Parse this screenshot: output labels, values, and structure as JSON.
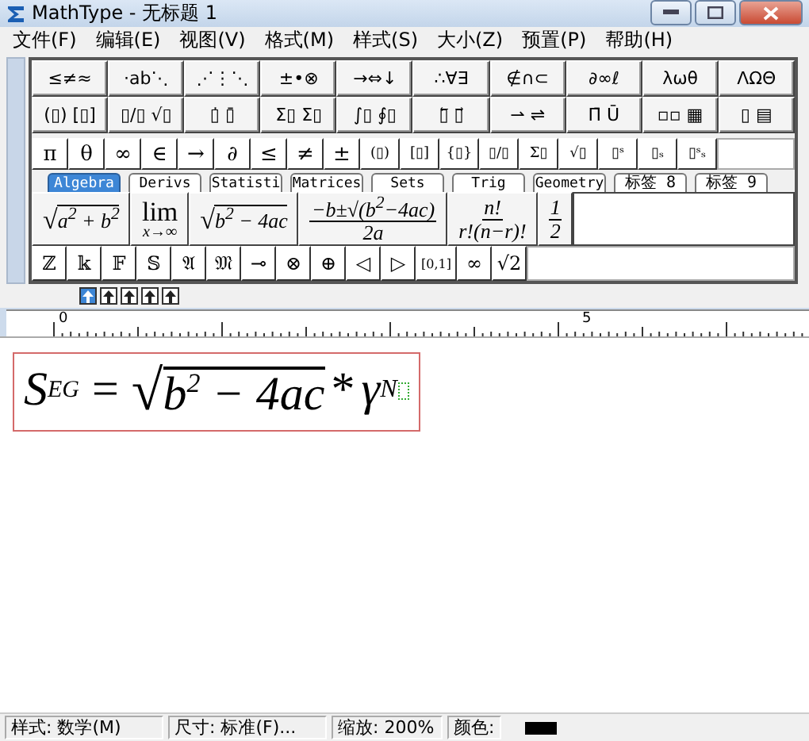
{
  "window": {
    "title": "MathType - 无标题 1"
  },
  "menu": [
    "文件(F)",
    "编辑(E)",
    "视图(V)",
    "格式(M)",
    "样式(S)",
    "大小(Z)",
    "预置(P)",
    "帮助(H)"
  ],
  "symbol_rows": [
    [
      "≤≠≈",
      "⋅ab⋱",
      "⋰⋮⋱",
      "±•⊗",
      "→⇔↓",
      "∴∀∃",
      "∉∩⊂",
      "∂∞ℓ",
      "λωθ",
      "ΛΩΘ"
    ],
    [
      "(▯) [▯]",
      "▯/▯ √▯",
      "▯̇ ▯̄",
      "Σ▯ Σ▯",
      "∫▯ ∮▯",
      "▯⃖ ▯⃗",
      "⇀ ⇌",
      "Π̄ Ū",
      "▫▫ ▦",
      "▯ ▤"
    ]
  ],
  "small_bar": [
    "π",
    "θ",
    "∞",
    "∈",
    "→",
    "∂",
    "≤",
    "≠",
    "±",
    "(▯)",
    "[▯]",
    "{▯}",
    "▯/▯",
    "Σ▯",
    "√▯",
    "▯ˢ",
    "▯ₛ",
    "▯ˢₛ"
  ],
  "tabs": [
    {
      "label": "Algebra",
      "selected": true
    },
    {
      "label": "Derivs",
      "selected": false
    },
    {
      "label": "Statisti",
      "selected": false
    },
    {
      "label": "Matrices",
      "selected": false
    },
    {
      "label": "Sets",
      "selected": false
    },
    {
      "label": "Trig",
      "selected": false
    },
    {
      "label": "Geometry",
      "selected": false
    },
    {
      "label": "标签 8",
      "selected": false
    },
    {
      "label": "标签 9",
      "selected": false
    }
  ],
  "templates": [
    {
      "kind": "radical",
      "sign": "√",
      "radicand": "a$^{2}$ + b$^{2}$"
    },
    {
      "kind": "limit",
      "top": "lim",
      "bottom": "x→∞"
    },
    {
      "kind": "radical",
      "sign": "√",
      "radicand": "b$^{2}$ − 4ac"
    },
    {
      "kind": "fraction",
      "num": "−b±√(b$^{2}$−4ac)",
      "den": "2a"
    },
    {
      "kind": "fraction",
      "num": "n!",
      "den": "r!(n−r)!"
    },
    {
      "kind": "fraction",
      "num": "1",
      "den": "2"
    }
  ],
  "bottom_bar": [
    "ℤ",
    "𝕜",
    "𝔽",
    "𝕊",
    "𝔄",
    "𝔐",
    "⊸",
    "⊗",
    "⊕",
    "◁",
    "▷",
    "[0,1]",
    "∞",
    "√2"
  ],
  "nudge_buttons": [
    {
      "selected": true
    },
    {
      "selected": false
    },
    {
      "selected": false
    },
    {
      "selected": false
    },
    {
      "selected": false
    }
  ],
  "ruler": {
    "labels": [
      "0",
      "5"
    ]
  },
  "equation": {
    "base": "S",
    "sub": "EG",
    "eq": "=",
    "sign": "√",
    "radicand": "b$^{2}$ − 4ac",
    "op": "*",
    "tail": "γ",
    "sup": "N"
  },
  "status_bar": {
    "style": "样式: 数学(M)",
    "size": "尺寸: 标准(F)...",
    "zoom": "缩放: 200%",
    "color_label": "颜色:",
    "color": "#000000"
  }
}
